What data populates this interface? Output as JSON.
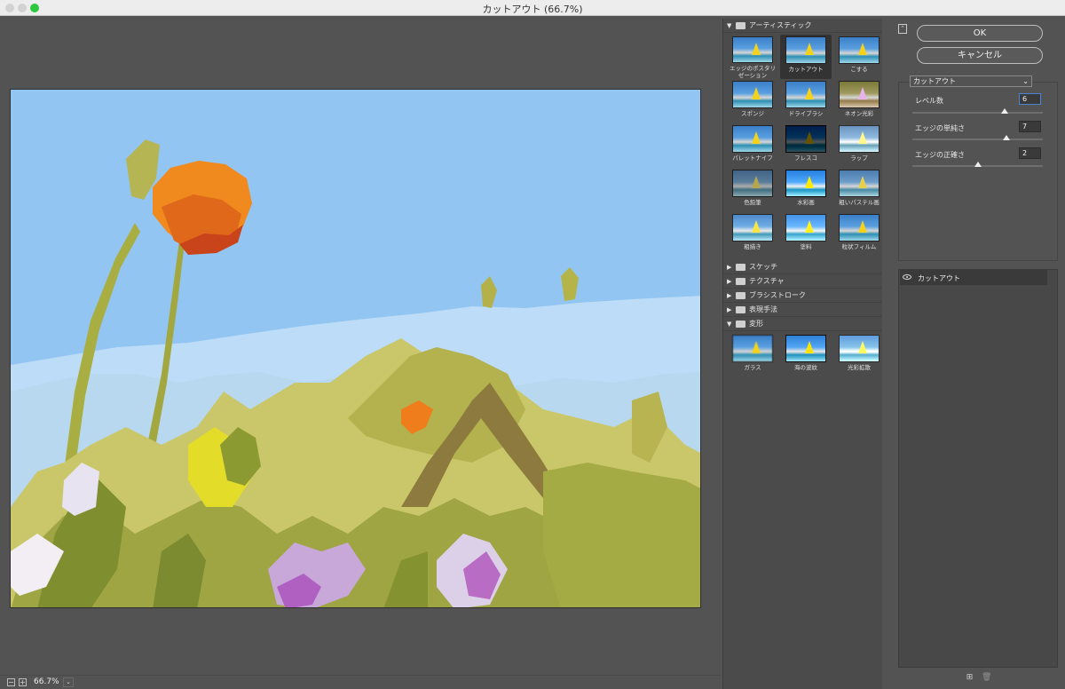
{
  "window": {
    "title": "カットアウト (66.7%)"
  },
  "preview": {
    "zoom": "66.7%",
    "zoom_out": "−",
    "zoom_in": "+",
    "zoom_menu": "⌄"
  },
  "gallery": {
    "categories": [
      {
        "label": "アーティスティック",
        "expanded": true,
        "filters": [
          "エッジのポスタリゼーション",
          "カットアウト",
          "こする",
          "スポンジ",
          "ドライブラシ",
          "ネオン光彩",
          "パレットナイフ",
          "フレスコ",
          "ラップ",
          "色鉛筆",
          "水彩画",
          "粗いパステル画",
          "粗描き",
          "塗料",
          "粒状フィルム"
        ]
      },
      {
        "label": "スケッチ",
        "expanded": false,
        "filters": []
      },
      {
        "label": "テクスチャ",
        "expanded": false,
        "filters": []
      },
      {
        "label": "ブラシストローク",
        "expanded": false,
        "filters": []
      },
      {
        "label": "表現手法",
        "expanded": false,
        "filters": []
      },
      {
        "label": "変形",
        "expanded": true,
        "filters": [
          "ガラス",
          "海の波紋",
          "光彩拡散"
        ]
      }
    ],
    "selected_filter": "カットアウト"
  },
  "buttons": {
    "ok": "OK",
    "cancel": "キャンセル"
  },
  "settings": {
    "filter_dropdown": "カットアウト",
    "params": [
      {
        "label": "レベル数",
        "value": "6",
        "fraction": 0.71
      },
      {
        "label": "エッジの単純さ",
        "value": "7",
        "fraction": 0.72
      },
      {
        "label": "エッジの正確さ",
        "value": "2",
        "fraction": 0.5
      }
    ]
  },
  "layers": {
    "items": [
      {
        "name": "カットアウト",
        "visible": true
      }
    ]
  },
  "icons": {
    "collapse": "⌃",
    "new_layer": "⊞",
    "delete": "🗑"
  }
}
